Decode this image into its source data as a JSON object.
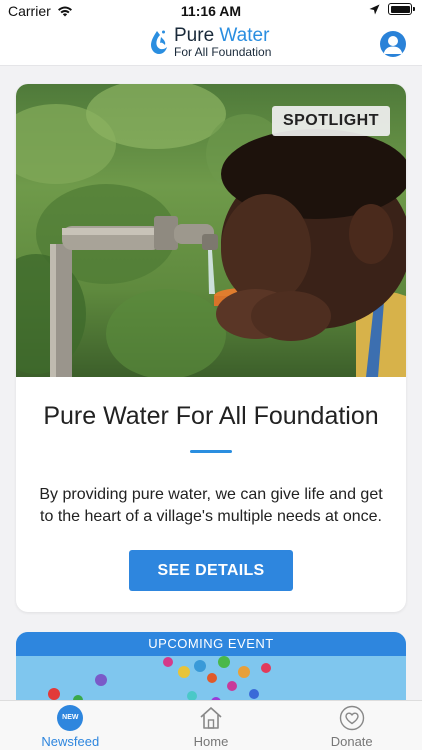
{
  "status_bar": {
    "carrier": "Carrier",
    "time": "11:16 AM"
  },
  "header": {
    "logo_line1_a": "Pure ",
    "logo_line1_b": "Water",
    "logo_line2": "For All Foundation"
  },
  "spotlight": {
    "tag": "SPOTLIGHT",
    "title": "Pure Water For All Foundation",
    "description": "By providing pure water, we can give life and get to the heart of a village's multiple needs at once.",
    "button_label": "SEE DETAILS"
  },
  "event": {
    "header": "UPCOMING EVENT"
  },
  "tab_bar": {
    "tabs": [
      {
        "label": "Newsfeed",
        "badge": "NEW",
        "icon": "new-badge-icon"
      },
      {
        "label": "Home",
        "icon": "home-icon"
      },
      {
        "label": "Donate",
        "icon": "heart-icon"
      }
    ]
  },
  "colors": {
    "accent": "#2e86de",
    "background": "#f2f2f4"
  }
}
